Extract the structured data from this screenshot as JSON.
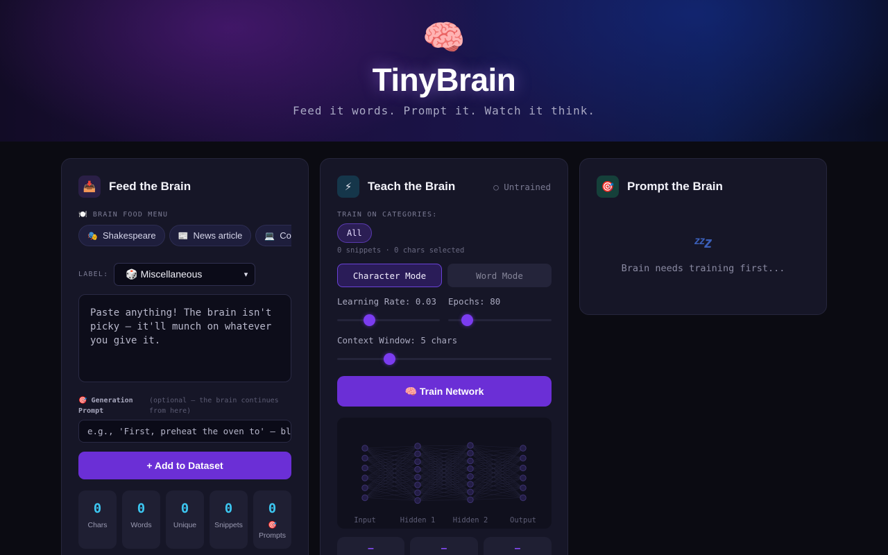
{
  "header": {
    "logo_emoji": "🧠",
    "title": "TinyBrain",
    "subtitle": "Feed it words. Prompt it. Watch it think."
  },
  "feed": {
    "icon": "📥",
    "title": "Feed the Brain",
    "menu_label": "🍽️ BRAIN FOOD MENU",
    "chips": [
      {
        "icon": "🎭",
        "label": "Shakespeare"
      },
      {
        "icon": "📰",
        "label": "News article"
      },
      {
        "icon": "💻",
        "label": "Code"
      }
    ],
    "label_label": "LABEL:",
    "label_select": "🎲 Miscellaneous",
    "textarea_placeholder": "Paste anything! The brain isn't picky — it'll munch on whatever you give it.",
    "gen_prompt_label": "🎯 Generation Prompt",
    "gen_prompt_hint": "(optional — the brain continues from here)",
    "prompt_placeholder": "e.g., 'First, preheat the oven to' — bl",
    "add_button": "+ Add to Dataset",
    "stats": [
      {
        "value": "0",
        "label": "Chars"
      },
      {
        "value": "0",
        "label": "Words"
      },
      {
        "value": "0",
        "label": "Unique"
      },
      {
        "value": "0",
        "label": "Snippets"
      },
      {
        "value": "0",
        "label": "🎯 Prompts"
      }
    ]
  },
  "teach": {
    "icon": "⚡",
    "title": "Teach the Brain",
    "status": "○ Untrained",
    "categories_label": "TRAIN ON CATEGORIES:",
    "category_all": "All",
    "selection_info": "0 snippets · 0 chars selected",
    "mode_char": "Character Mode",
    "mode_word": "Word Mode",
    "learning_rate_label": "Learning Rate: 0.03",
    "epochs_label": "Epochs: 80",
    "context_label": "Context Window: 5 chars",
    "train_button": "🧠 Train Network",
    "net_layers": [
      "Input",
      "Hidden 1",
      "Hidden 2",
      "Output"
    ],
    "mini_values": [
      "–",
      "–",
      "–"
    ]
  },
  "prompt": {
    "icon": "🎯",
    "title": "Prompt the Brain",
    "sleep_icon": "zzz",
    "message": "Brain needs training first..."
  }
}
